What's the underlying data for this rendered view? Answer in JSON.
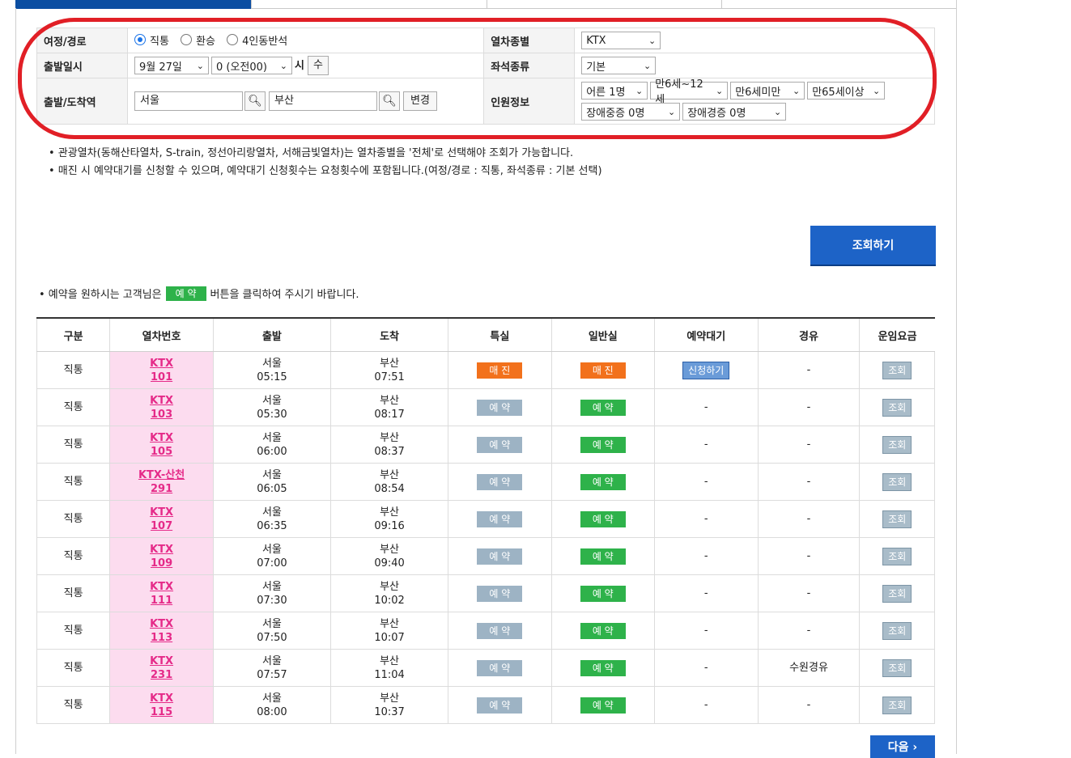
{
  "form": {
    "route_label": "여정/경로",
    "route_options": [
      "직통",
      "환승",
      "4인동반석"
    ],
    "date_label": "출발일시",
    "date_value": "9월 27일",
    "time_value": "0 (오전00)",
    "hour_suffix": "시",
    "weekday": "수",
    "station_label": "출발/도착역",
    "departure": "서울",
    "arrival": "부산",
    "change_label": "변경",
    "train_type_label": "열차종별",
    "train_type_value": "KTX",
    "seat_type_label": "좌석종류",
    "seat_type_value": "기본",
    "passenger_label": "인원정보",
    "passengers": [
      "어른 1명",
      "만6세~12세",
      "만6세미만",
      "만65세이상",
      "장애중증 0명",
      "장애경증 0명"
    ]
  },
  "notes": [
    "• 관광열차(동해산타열차, S-train, 정선아리랑열차, 서해금빛열차)는 열차종별을 '전체'로 선택해야 조회가 가능합니다.",
    "• 매진 시 예약대기를 신청할 수 있으며, 예약대기 신청횟수는 요청횟수에 포함됩니다.(여정/경로 : 직통, 좌석종류 : 기본 선택)"
  ],
  "search_button": "조회하기",
  "reserve_note": {
    "prefix": "• 예약을 원하시는 고객님은",
    "tag": "예 약",
    "suffix": "버튼을 클릭하여 주시기 바랍니다."
  },
  "table": {
    "headers": [
      "구분",
      "열차번호",
      "출발",
      "도착",
      "특실",
      "일반실",
      "예약대기",
      "경유",
      "운임요금"
    ],
    "rows": [
      {
        "type": "직통",
        "train": "KTX",
        "no": "101",
        "dep": "서울",
        "dep_t": "05:15",
        "arr": "부산",
        "arr_t": "07:51",
        "first": "매 진",
        "std": "매 진",
        "wait": "신청하기",
        "via": "-",
        "fare": "조회"
      },
      {
        "type": "직통",
        "train": "KTX",
        "no": "103",
        "dep": "서울",
        "dep_t": "05:30",
        "arr": "부산",
        "arr_t": "08:17",
        "first": "예 약",
        "std": "예 약",
        "wait": "-",
        "via": "-",
        "fare": "조회"
      },
      {
        "type": "직통",
        "train": "KTX",
        "no": "105",
        "dep": "서울",
        "dep_t": "06:00",
        "arr": "부산",
        "arr_t": "08:37",
        "first": "예 약",
        "std": "예 약",
        "wait": "-",
        "via": "-",
        "fare": "조회"
      },
      {
        "type": "직통",
        "train": "KTX-산천",
        "no": "291",
        "dep": "서울",
        "dep_t": "06:05",
        "arr": "부산",
        "arr_t": "08:54",
        "first": "예 약",
        "std": "예 약",
        "wait": "-",
        "via": "-",
        "fare": "조회"
      },
      {
        "type": "직통",
        "train": "KTX",
        "no": "107",
        "dep": "서울",
        "dep_t": "06:35",
        "arr": "부산",
        "arr_t": "09:16",
        "first": "예 약",
        "std": "예 약",
        "wait": "-",
        "via": "-",
        "fare": "조회"
      },
      {
        "type": "직통",
        "train": "KTX",
        "no": "109",
        "dep": "서울",
        "dep_t": "07:00",
        "arr": "부산",
        "arr_t": "09:40",
        "first": "예 약",
        "std": "예 약",
        "wait": "-",
        "via": "-",
        "fare": "조회"
      },
      {
        "type": "직통",
        "train": "KTX",
        "no": "111",
        "dep": "서울",
        "dep_t": "07:30",
        "arr": "부산",
        "arr_t": "10:02",
        "first": "예 약",
        "std": "예 약",
        "wait": "-",
        "via": "-",
        "fare": "조회"
      },
      {
        "type": "직통",
        "train": "KTX",
        "no": "113",
        "dep": "서울",
        "dep_t": "07:50",
        "arr": "부산",
        "arr_t": "10:07",
        "first": "예 약",
        "std": "예 약",
        "wait": "-",
        "via": "-",
        "fare": "조회"
      },
      {
        "type": "직통",
        "train": "KTX",
        "no": "231",
        "dep": "서울",
        "dep_t": "07:57",
        "arr": "부산",
        "arr_t": "11:04",
        "first": "예 약",
        "std": "예 약",
        "wait": "-",
        "via": "수원경유",
        "fare": "조회"
      },
      {
        "type": "직통",
        "train": "KTX",
        "no": "115",
        "dep": "서울",
        "dep_t": "08:00",
        "arr": "부산",
        "arr_t": "10:37",
        "first": "예 약",
        "std": "예 약",
        "wait": "-",
        "via": "-",
        "fare": "조회"
      }
    ]
  },
  "next_button": "다음 ›"
}
